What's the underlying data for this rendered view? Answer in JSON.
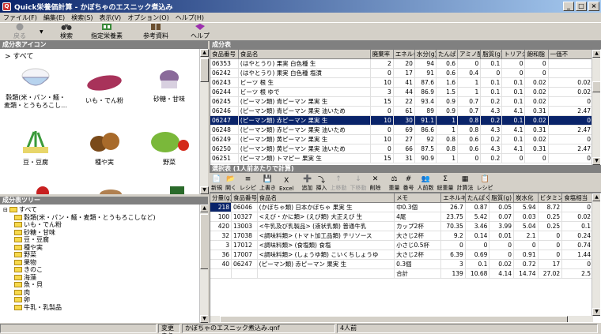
{
  "window": {
    "title": "Quick栄養価計算 - かぼちゃのエスニック煮込み",
    "app_icon": "Q"
  },
  "menu": [
    "ファイル(F)",
    "編集(E)",
    "検索(S)",
    "表示(V)",
    "オプション(O)",
    "ヘルプ(H)"
  ],
  "toolbar": {
    "back": "戻る",
    "search": "検索",
    "designated": "指定栄養素",
    "reference": "参考資料",
    "help": "ヘルプ"
  },
  "icon_panel": {
    "title": "成分表アイコン",
    "all_label": "> すべて",
    "items": [
      "穀類(米・パン・麺・麦類・とうもろこし…",
      "いも・でん粉",
      "砂糖・甘味",
      "豆・豆腐",
      "種や実",
      "野菜"
    ]
  },
  "tree_panel": {
    "title": "成分表ツリー",
    "root": "すべて",
    "items": [
      "穀類(米・パン・麺・麦類・とうもろこしなど)",
      "いも・でん粉",
      "砂糖・甘味",
      "豆・豆腐",
      "種や実",
      "野菜",
      "果物",
      "きのこ",
      "海藻",
      "魚・貝",
      "肉",
      "卵",
      "牛乳・乳製品"
    ]
  },
  "composition": {
    "title": "成分表",
    "columns": [
      "食品番号",
      "食品名",
      "廃棄率",
      "エネルギ",
      "水分(g)",
      "たんぱく",
      "アミノ酸",
      "脂質(g)",
      "トリアシ",
      "飽和脂",
      "一価不"
    ],
    "rows": [
      [
        "06353",
        "(はやとうり) 果実 白色種 生",
        "2",
        "20",
        "94",
        "0.6",
        "0",
        "0.1",
        "0",
        "0",
        ""
      ],
      [
        "06242",
        "(はやとうり) 果実 白色種 塩漬",
        "0",
        "17",
        "91",
        "0.6",
        "0.4",
        "0",
        "0",
        "0",
        ""
      ],
      [
        "06243",
        "ビーツ 根 生",
        "10",
        "41",
        "87.6",
        "1.6",
        "1",
        "0.1",
        "0.1",
        "0.02",
        "0.02"
      ],
      [
        "06244",
        "ビーツ 根 ゆで",
        "3",
        "44",
        "86.9",
        "1.5",
        "1",
        "0.1",
        "0.1",
        "0.02",
        "0.02"
      ],
      [
        "06245",
        "(ピーマン類) 青ピーマン 果実 生",
        "15",
        "22",
        "93.4",
        "0.9",
        "0.7",
        "0.2",
        "0.1",
        "0.02",
        "0"
      ],
      [
        "06246",
        "(ピーマン類) 青ピーマン 果実 油いため",
        "0",
        "61",
        "89",
        "0.9",
        "0.7",
        "4.3",
        "4.1",
        "0.31",
        "2.47"
      ],
      [
        "06247",
        "(ピーマン類) 赤ピーマン 果実 生",
        "10",
        "30",
        "91.1",
        "1",
        "0.8",
        "0.2",
        "0.1",
        "0.02",
        "0"
      ],
      [
        "06248",
        "(ピーマン類) 赤ピーマン 果実 油いため",
        "0",
        "69",
        "86.6",
        "1",
        "0.8",
        "4.3",
        "4.1",
        "0.31",
        "2.47"
      ],
      [
        "06249",
        "(ピーマン類) 黄ピーマン 果実 生",
        "10",
        "27",
        "92",
        "0.8",
        "0.6",
        "0.2",
        "0.1",
        "0.02",
        "0"
      ],
      [
        "06250",
        "(ピーマン類) 黄ピーマン 果実 油いため",
        "0",
        "66",
        "87.5",
        "0.8",
        "0.6",
        "4.3",
        "4.1",
        "0.31",
        "2.47"
      ],
      [
        "06251",
        "(ピーマン類) トマピー 果実 生",
        "15",
        "31",
        "90.9",
        "1",
        "0",
        "0.2",
        "0",
        "0",
        "0"
      ]
    ]
  },
  "selection": {
    "title": "選択表 (1人前あたりで計算)",
    "buttons": [
      "新規",
      "開く",
      "レシピ",
      "上書き",
      "Excel",
      "追加",
      "挿入",
      "上移動",
      "下移動",
      "削除",
      "重量",
      "番号",
      "人前数",
      "総重量",
      "計算法",
      "レシピ"
    ],
    "columns": [
      "分量(g)",
      "食品番号",
      "食品名",
      "メモ",
      "エネルギ",
      "たんぱく",
      "脂質(g)",
      "炭水化",
      "ビタミン",
      "食塩相当"
    ],
    "rows": [
      [
        "218",
        "06046",
        "(かぼちゃ類) 日本かぼちゃ 果実 生",
        "中0.3個",
        "26.7",
        "0.87",
        "0.05",
        "5.94",
        "8.72",
        "0"
      ],
      [
        "100",
        "10327",
        "<えび・かに類> (えび類) 大正えび 生",
        "4尾",
        "23.75",
        "5.42",
        "0.07",
        "0.03",
        "0.25",
        "0.02"
      ],
      [
        "420",
        "13003",
        "<牛乳及び乳製品> (液状乳類) 普通牛乳",
        "カップ2杯",
        "70.35",
        "3.46",
        "3.99",
        "5.04",
        "0.25",
        "0.1"
      ],
      [
        "32",
        "17038",
        "<調味料類> (トマト加工品類) チリソース",
        "大さじ2杯",
        "9.2",
        "0.14",
        "0.01",
        "2.1",
        "0",
        "0.24"
      ],
      [
        "3",
        "17012",
        "<調味料類> (食塩類) 食塩",
        "小さじ0.5杯",
        "0",
        "0",
        "0",
        "0",
        "0",
        "0.74"
      ],
      [
        "36",
        "17007",
        "<調味料類> (しょうゆ類) こいくちしょうゆ",
        "大さじ2杯",
        "6.39",
        "0.69",
        "0",
        "0.91",
        "0",
        "1.44"
      ],
      [
        "40",
        "06247",
        "(ピーマン類) 赤ピーマン 果実 生",
        "0.3個",
        "3",
        "0.1",
        "0.02",
        "0.72",
        "17",
        "0"
      ]
    ],
    "total": [
      "",
      "",
      "",
      "合計",
      "139",
      "10.68",
      "4.14",
      "14.74",
      "27.02",
      "2.5"
    ]
  },
  "status": {
    "changed": "変更あり",
    "file": "かぼちゃのエスニック煮込み.qnf",
    "servings": "4人前"
  }
}
